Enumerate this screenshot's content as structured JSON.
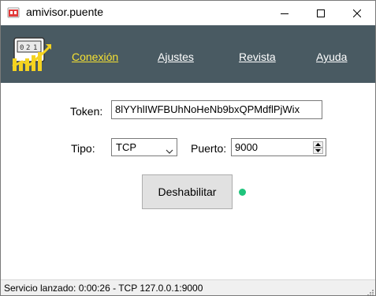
{
  "window": {
    "title": "amivisor.puente",
    "icons": {
      "app": "app-logo-icon",
      "minimize": "minimize-icon",
      "maximize": "maximize-icon",
      "close": "close-icon"
    }
  },
  "nav": {
    "items": [
      {
        "label": "Conexión",
        "active": true
      },
      {
        "label": "Ajustes",
        "active": false
      },
      {
        "label": "Revista",
        "active": false
      },
      {
        "label": "Ayuda",
        "active": false
      }
    ],
    "logo_icon": "bridge-logo-icon"
  },
  "form": {
    "token_label": "Token:",
    "token_value": "8lYYhlIWFBUhNoHeNb9bxQPMdflPjWix",
    "tipo_label": "Tipo:",
    "tipo_value": "TCP",
    "puerto_label": "Puerto:",
    "puerto_value": "9000",
    "disable_button": "Deshabilitar",
    "status_indicator": "green-dot-icon"
  },
  "status_bar": {
    "text": "Servicio lanzado: 0:00:26 - TCP 127.0.0.1:9000"
  },
  "colors": {
    "nav_bg": "#495a62",
    "nav_active": "#f5e133",
    "nav_text": "#ffffff",
    "status_dot": "#1fc47c",
    "logo_yellow": "#f5d320"
  }
}
